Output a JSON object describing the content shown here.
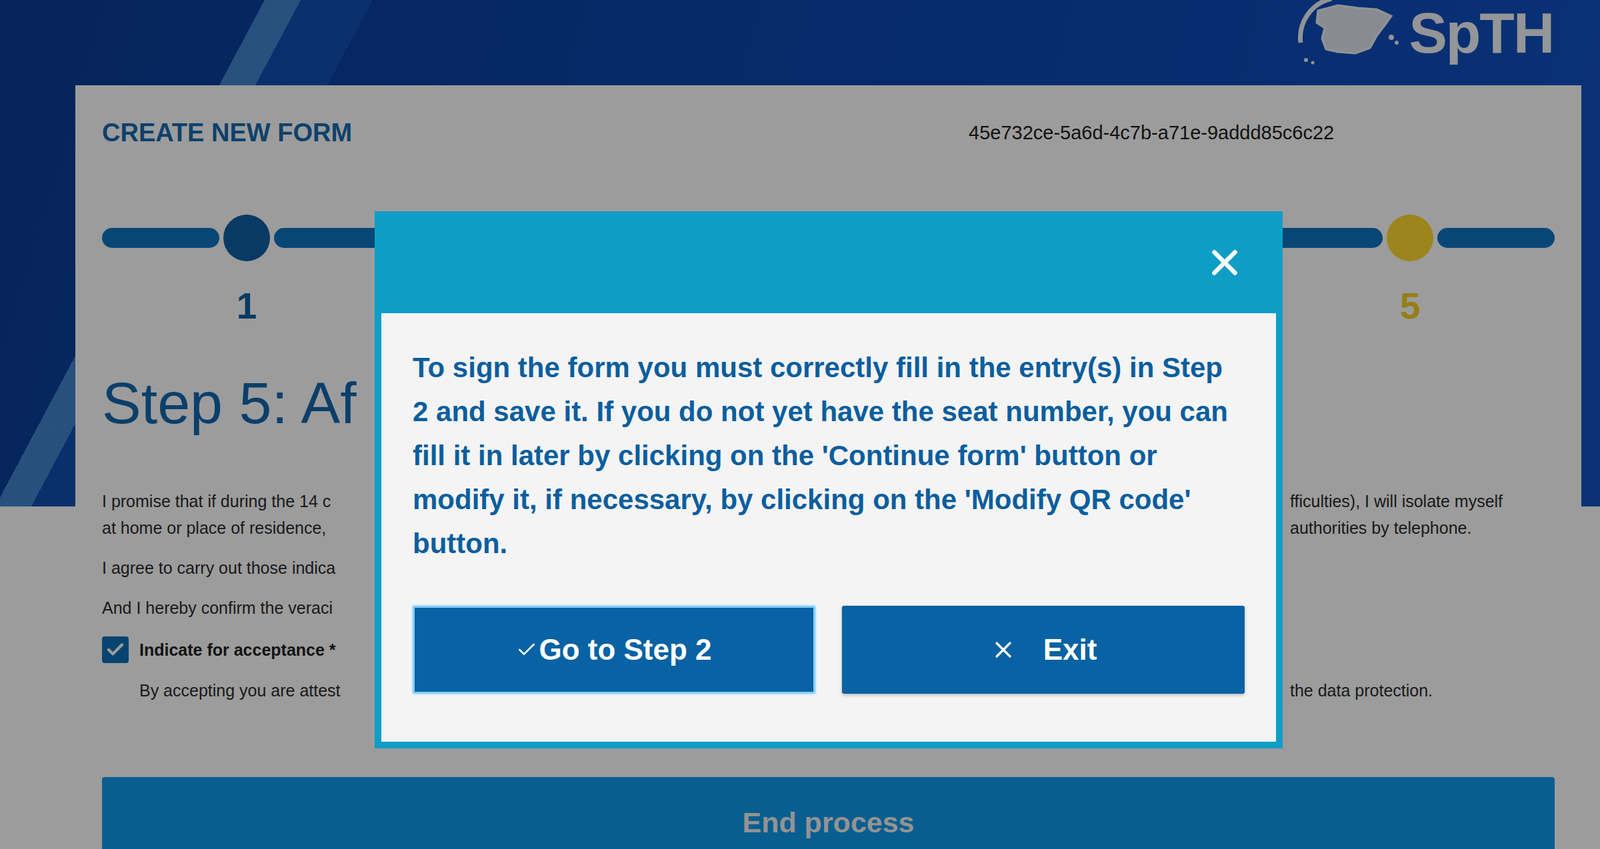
{
  "header": {
    "logo": "SpTH"
  },
  "form": {
    "title": "CREATE NEW FORM",
    "id": "45e732ce-5a6d-4c7b-a71e-9addd85c6c22"
  },
  "steps": [
    {
      "label": "1",
      "selected": false
    },
    {
      "label": "5",
      "selected": true
    }
  ],
  "heading": "Step 5: Af",
  "paragraphs": [
    {
      "lines": [
        {
          "left": "I promise that if during the 14 c",
          "right": "fficulties), I will isolate myself"
        },
        {
          "left": "at home or place of residence,",
          "right": "authorities by telephone."
        }
      ]
    },
    {
      "lines": [
        {
          "left": "I agree to carry out those indica"
        }
      ]
    },
    {
      "lines": [
        {
          "left": "And I hereby confirm the veraci"
        }
      ]
    }
  ],
  "acceptance": {
    "label": "Indicate for acceptance *",
    "checked": true,
    "note": {
      "left": "By accepting you are attest",
      "right": "the data protection."
    }
  },
  "end_button": {
    "label": "End process",
    "disabled": true
  },
  "dialog": {
    "message": "To sign the form you must correctly fill in the entry(s) in Step 2 and save it. If you do not yet have the seat number, you can fill it in later by clicking on the 'Continue form' button or modify it, if necessary, by clicking on the 'Modify QR code' button.",
    "buttons": [
      {
        "label": "Go to Step 2",
        "kind": "confirm",
        "focused": true
      },
      {
        "label": "Exit",
        "kind": "cancel",
        "focused": false
      }
    ]
  }
}
